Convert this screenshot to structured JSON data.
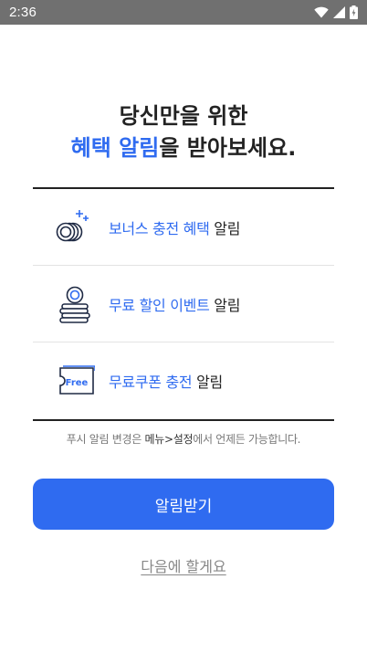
{
  "status_bar": {
    "time": "2:36",
    "icons": [
      "wifi-icon",
      "cell-signal-icon",
      "battery-icon"
    ]
  },
  "headline": {
    "line1": "당신만을 위한",
    "line2_accent": "혜택 알림",
    "line2_rest": "을 받아보세요."
  },
  "benefits": [
    {
      "icon": "coins-sparkle-icon",
      "accent": "보너스 충전 혜택",
      "rest": " 알림"
    },
    {
      "icon": "coin-stack-icon",
      "accent": "무료 할인 이벤트",
      "rest": " 알림"
    },
    {
      "icon": "free-coupon-icon",
      "icon_text": "Free",
      "accent": "무료쿠폰 충전",
      "rest": " 알림"
    }
  ],
  "notice": {
    "prefix": "푸시 알림 변경은 ",
    "path": "메뉴>설정",
    "suffix": "에서 언제든 가능합니다."
  },
  "primary_button": {
    "label": "알림받기"
  },
  "later_link": {
    "label": "다음에 할게요"
  },
  "colors": {
    "accent": "#2f6bf0",
    "status_bar": "#707070",
    "text": "#222222",
    "muted": "#888888"
  }
}
